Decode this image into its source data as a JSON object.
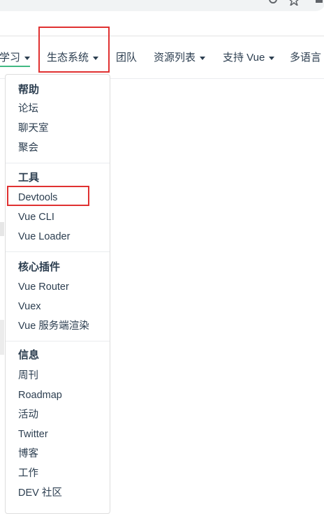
{
  "navbar": {
    "items": [
      {
        "label": "学习",
        "has_caret": true
      },
      {
        "label": "生态系统",
        "has_caret": true
      },
      {
        "label": "团队",
        "has_caret": false
      },
      {
        "label": "资源列表",
        "has_caret": true
      },
      {
        "label": "支持 Vue",
        "has_caret": true
      },
      {
        "label": "多语言",
        "has_caret": false
      }
    ]
  },
  "dropdown": {
    "groups": [
      {
        "title": "帮助",
        "links": [
          "论坛",
          "聊天室",
          "聚会"
        ]
      },
      {
        "title": "工具",
        "links": [
          "Devtools",
          "Vue CLI",
          "Vue Loader"
        ]
      },
      {
        "title": "核心插件",
        "links": [
          "Vue Router",
          "Vuex",
          "Vue 服务端渲染"
        ]
      },
      {
        "title": "信息",
        "links": [
          "周刊",
          "Roadmap",
          "活动",
          "Twitter",
          "博客",
          "工作",
          "DEV 社区"
        ]
      }
    ]
  },
  "colors": {
    "text": "#2c3e50",
    "accent": "#42b983",
    "highlight": "#e03131"
  },
  "icons": [
    "key-icon",
    "star-icon",
    "puzzle-icon"
  ]
}
